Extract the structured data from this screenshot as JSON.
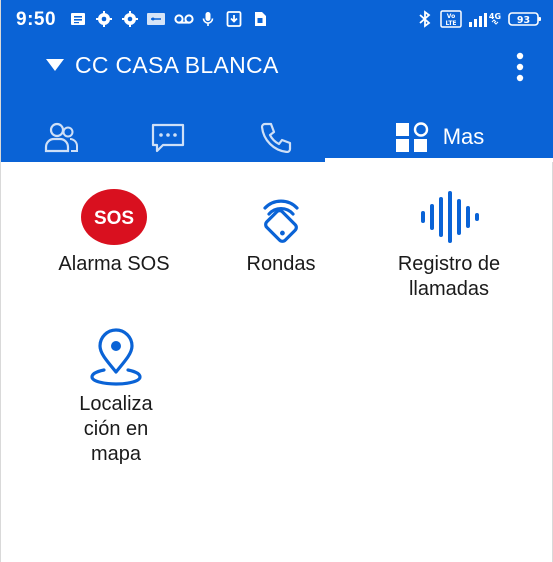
{
  "status_bar": {
    "time": "9:50",
    "battery": "93",
    "network": "4G"
  },
  "toolbar": {
    "title": "CC CASA BLANCA"
  },
  "tabs": [
    {
      "name": "contacts",
      "icon": "people-icon"
    },
    {
      "name": "messages",
      "icon": "chat-icon"
    },
    {
      "name": "calls",
      "icon": "phone-icon"
    },
    {
      "name": "more",
      "icon": "dashboard-icon",
      "label": "Mas",
      "selected": true
    }
  ],
  "menu": {
    "items": [
      {
        "id": "sos",
        "label": "Alarma SOS",
        "icon": "sos-icon",
        "icon_text": "SOS",
        "color": "#d9101f"
      },
      {
        "id": "rondas",
        "label": "Rondas",
        "icon": "nfc-tag-icon",
        "color": "#0a63d6"
      },
      {
        "id": "registro",
        "label_lines": [
          "Registro de",
          "llamadas"
        ],
        "icon": "soundwave-icon",
        "color": "#0a63d6"
      },
      {
        "id": "localizacion",
        "label_lines": [
          "Localiza",
          "ción en",
          "mapa"
        ],
        "icon": "location-pin-icon",
        "color": "#0a63d6"
      }
    ]
  },
  "colors": {
    "primary": "#0a63d6",
    "sos_red": "#d9101f",
    "text": "#1a1a1a"
  }
}
